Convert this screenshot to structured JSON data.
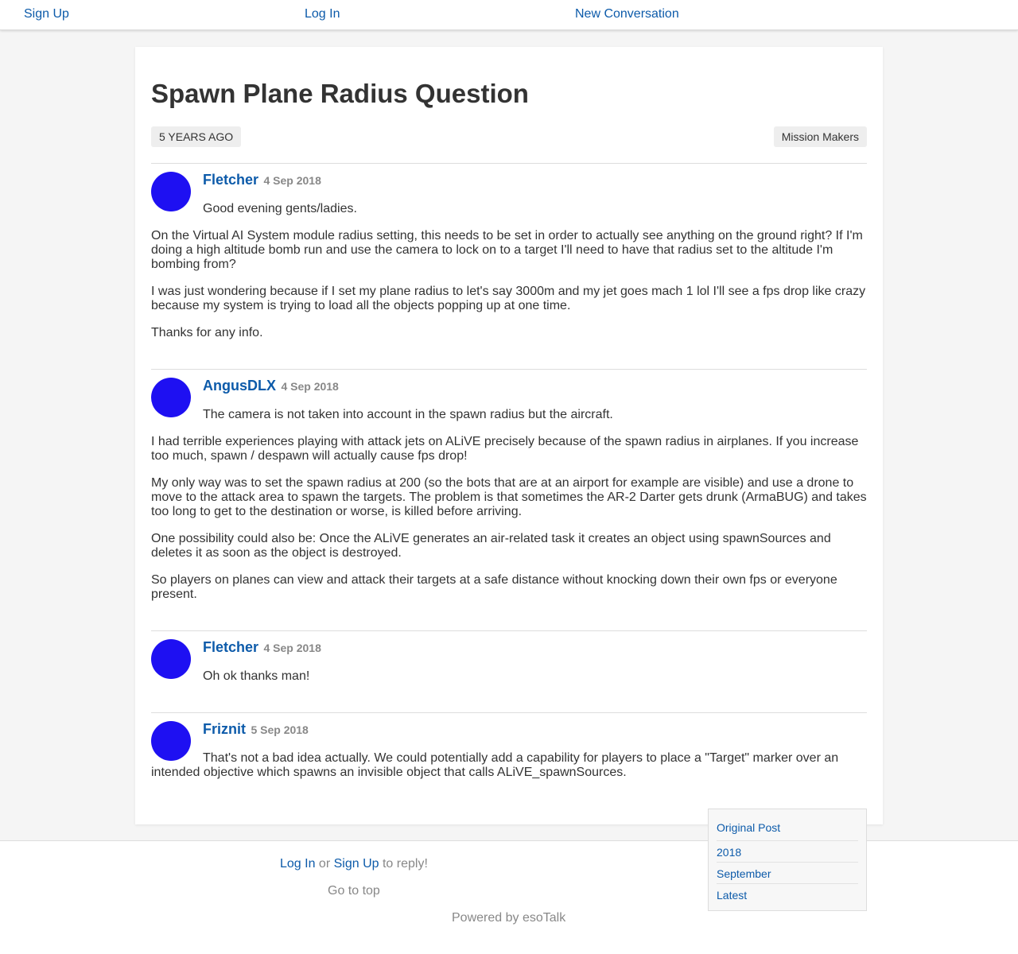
{
  "nav": {
    "signup": "Sign Up",
    "login": "Log In",
    "new_conversation": "New Conversation"
  },
  "conversation": {
    "title": "Spawn Plane Radius Question",
    "age": "5 YEARS AGO",
    "channel": "Mission Makers"
  },
  "posts": [
    {
      "author": "Fletcher",
      "date": "4 Sep 2018",
      "paragraphs": [
        "Good evening gents/ladies.",
        "On the Virtual AI System module radius setting, this needs to be set in order to actually see anything on the ground right? If I'm doing a high altitude bomb run and use the camera to lock on to a target I'll need to have that radius set to the altitude I'm bombing from?",
        "I was just wondering because if I set my plane radius to let's say 3000m and my jet goes mach 1 lol I'll see a fps drop like crazy because my system is trying to load all the objects popping up at one time.",
        "Thanks for any info."
      ]
    },
    {
      "author": "AngusDLX",
      "date": "4 Sep 2018",
      "paragraphs": [
        "The camera is not taken into account in the spawn radius but the aircraft.",
        "I had terrible experiences playing with attack jets on ALiVE precisely because of the spawn radius in airplanes. If you increase too much, spawn / despawn will actually cause fps drop!",
        "My only way was to set the spawn radius at 200 (so the bots that are at an airport for example are visible) and use a drone to move to the attack area to spawn the targets. The problem is that sometimes the AR-2 Darter gets drunk (ArmaBUG) and takes too long to get to the destination or worse, is killed before arriving.",
        "One possibility could also be: Once the ALiVE generates an air-related task it creates an object using spawnSources and deletes it as soon as the object is destroyed.",
        "So players on planes can view and attack their targets at a safe distance without knocking down their own fps or everyone present."
      ]
    },
    {
      "author": "Fletcher",
      "date": "4 Sep 2018",
      "paragraphs": [
        "Oh ok thanks man!"
      ]
    },
    {
      "author": "Friznit",
      "date": "5 Sep 2018",
      "paragraphs": [
        "That's not a bad idea actually. We could potentially add a capability for players to place a \"Target\" marker over an intended objective which spawns an invisible object that calls ALiVE_spawnSources."
      ]
    }
  ],
  "footer": {
    "login": "Log In",
    "or": " or ",
    "signup": "Sign Up",
    "to_reply": " to reply!",
    "go_to_top": "Go to top",
    "powered_by": "Powered by esoTalk"
  },
  "scrubber": {
    "items": [
      "Original Post",
      "2018",
      "September",
      "Latest"
    ]
  },
  "colors": {
    "link": "#0d5baa",
    "avatar": "#1e10f2"
  }
}
